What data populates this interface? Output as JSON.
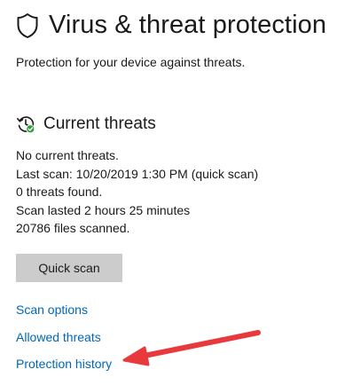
{
  "header": {
    "icon": "shield-icon",
    "title": "Virus & threat protection",
    "subtitle": "Protection for your device against threats."
  },
  "current_threats": {
    "icon": "threat-history-icon",
    "title": "Current threats",
    "status": {
      "no_threats": "No current threats.",
      "last_scan": "Last scan: 10/20/2019 1:30 PM (quick scan)",
      "threats_found": "0 threats found.",
      "scan_duration": "Scan lasted 2 hours 25 minutes",
      "files_scanned": "20786 files scanned."
    },
    "quick_scan_label": "Quick scan"
  },
  "links": {
    "scan_options": "Scan options",
    "allowed_threats": "Allowed threats",
    "protection_history": "Protection history"
  },
  "colors": {
    "link": "#0067b8",
    "button_bg": "#cccccc",
    "annotation_arrow": "#e8393d",
    "status_ok": "#2e9e3a"
  }
}
